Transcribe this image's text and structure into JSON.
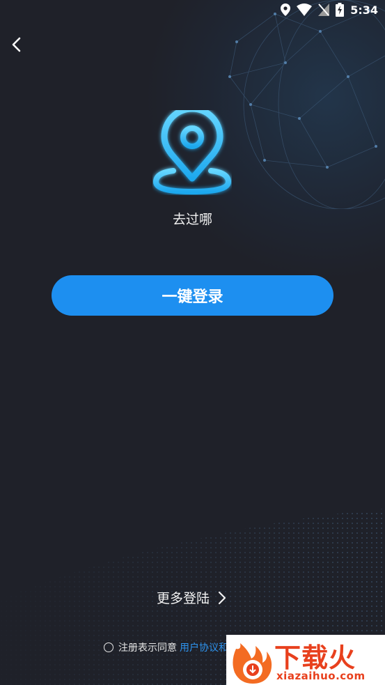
{
  "status_bar": {
    "time": "5:34"
  },
  "header": {
    "back_icon": "chevron-left-icon"
  },
  "logo": {
    "icon": "map-pin-icon",
    "app_name": "去过哪"
  },
  "login": {
    "one_click_label": "一键登录"
  },
  "more_login": {
    "label": "更多登陆",
    "icon": "chevron-right-icon"
  },
  "agreement": {
    "text": "注册表示同意",
    "link": "用户协议",
    "trailing": "和"
  },
  "watermark": {
    "text": "下载火",
    "url": "xiazaihuo.com"
  },
  "colors": {
    "background": "#1f2129",
    "accent": "#1d8ff0",
    "link": "#2d93ee",
    "watermark": "#e8401d"
  }
}
